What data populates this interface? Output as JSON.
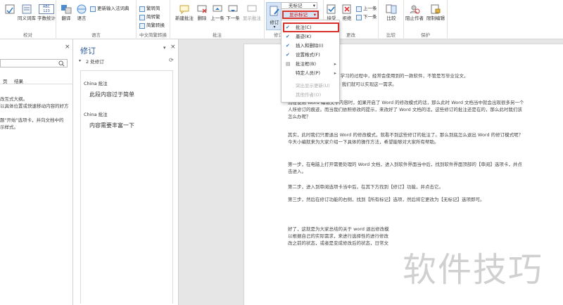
{
  "ribbon": {
    "groups": [
      {
        "label": "校对"
      },
      {
        "label": "语言"
      },
      {
        "label": "中文简繁转换"
      },
      {
        "label": "批注"
      },
      {
        "label": "修订"
      },
      {
        "label": "更改"
      },
      {
        "label": "比较"
      },
      {
        "label": "保护"
      }
    ],
    "buttons": {
      "spelling": "",
      "thesaurus": "同义词库",
      "wordcount": "字数统计",
      "translate": "翻译",
      "language": "语言",
      "update_ime": "更新输入法词典",
      "to_simplified": "繁转简",
      "to_traditional": "简转繁",
      "convert": "简繁转换",
      "new_comment": "新建批注",
      "delete": "删除",
      "prev": "上一条",
      "next": "下一条",
      "show_comments": "显示批注",
      "track_changes": "修订",
      "accept": "接受",
      "reject": "拒绝",
      "prev_change": "上一条",
      "next_change": "下一条",
      "compare": "比较",
      "block_authors": "阻止作者",
      "restrict_editing": "限制编辑"
    },
    "markup_select": "无标记",
    "show_markup": "显示标记",
    "wordcount_icon": "ABC 123"
  },
  "menu": {
    "items": [
      {
        "label": "批注(C)",
        "checked": true
      },
      {
        "label": "墨迹(K)",
        "checked": true
      },
      {
        "label": "插入和删除(I)",
        "checked": true
      },
      {
        "label": "设置格式(F)",
        "checked": true
      },
      {
        "label": "批注框(B)",
        "checked": false,
        "submenu": true
      },
      {
        "label": "特定人员(P)",
        "checked": false,
        "submenu": true
      },
      {
        "label": "突出显示更新(U)",
        "checked": false,
        "disabled": true
      },
      {
        "label": "其他作者(O)",
        "checked": false,
        "disabled": true
      }
    ]
  },
  "nav": {
    "close": "×",
    "tab": "结果",
    "lines": [
      "改互式大纲。",
      "以具体位置或快速移动内容的好方",
      "",
      "题\"开始\"选项卡，并向文档中的",
      "示样式。"
    ]
  },
  "revisions": {
    "title": "修订",
    "count": "2 处修订",
    "items": [
      {
        "author": "China",
        "type": "批注",
        "text": "此段内容过于简单"
      },
      {
        "author": "China",
        "type": "批注",
        "text": "内容需要丰富一下"
      }
    ]
  },
  "document": {
    "p0": "或学习的过程中，经常会使用到的一款软件，不管是写毕业论文，",
    "p0b": "rd 我们就可以实现这一需求。",
    "p1": "而在使用 Word 编辑文字内容时，如果开启了 Word 的修改模式的话，那么此时 Word 文档当中就会出现很多另一个人所修订的痕迹。而当我们依照修改的提示，来改好了 Word 文档的话，这些修订的批注还是在的，那么此时我们该怎么办呢？",
    "p2": "其实，此时我们只要退出 Word 的修改模式，就看不到这些修订的批注了。那么到底怎么退出 Word 的修订模式呢？今天小编就来为大家介绍一下具体的操作方法，希望能够对大家所有帮助。",
    "p3": "第一步，在电脑上打开需要处理的 Word 文档，进入到软件界面当中后，找到软件界面顶部的【审阅】选项卡，并点击进入。",
    "p4": "第二步，进入到审阅选项卡当中后，在其下方找到【修订】功能，并点击它。",
    "p5": "第三步，然后在修订功能的右侧，找到【所有标记】选项，然后将它更改为【无标记】选项即可。",
    "p6a": "好了，这就是为大家总结的关于 word 退出修改模",
    "p6b": "以根据自己的实际需求，来进行选择性的进行修改",
    "p6c": "改之前的状态，或者是变成修改后的状态，日常文"
  },
  "watermark": "软件技巧",
  "colors": {
    "accent": "#2b579a",
    "highlight": "#d9302c"
  }
}
